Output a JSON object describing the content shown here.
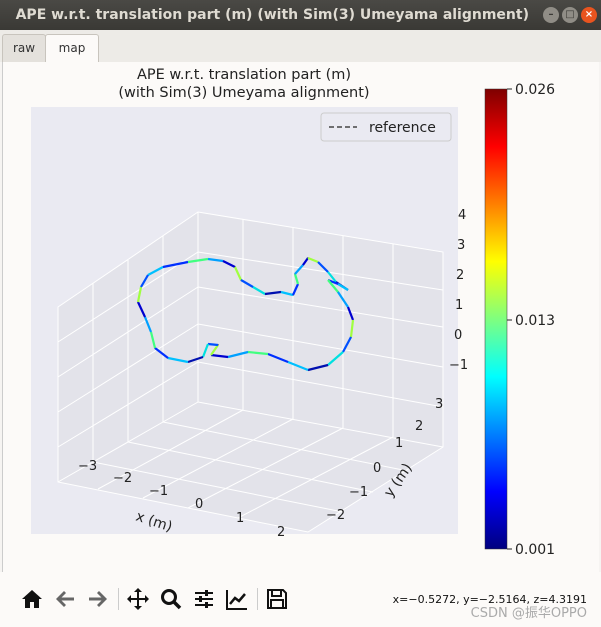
{
  "window": {
    "title": "APE w.r.t. translation part (m) (with Sim(3) Umeyama alignment)"
  },
  "tabs": [
    {
      "label": "raw",
      "active": false
    },
    {
      "label": "map",
      "active": true
    }
  ],
  "plot": {
    "title_line1": "APE w.r.t. translation part (m)",
    "title_line2": "(with Sim(3) Umeyama alignment)",
    "legend": "reference",
    "xlabel": "x (m)",
    "ylabel": "y (m)",
    "xticks": [
      "−3",
      "−2",
      "−1",
      "0",
      "1",
      "2"
    ],
    "yticks": [
      "−2",
      "−1",
      "0",
      "1",
      "2",
      "3"
    ],
    "zticks": [
      "−1",
      "0",
      "1",
      "2",
      "3",
      "4"
    ],
    "colorbar": {
      "colormap": "jet",
      "min": "0.001",
      "mid": "0.013",
      "max": "0.026"
    }
  },
  "toolbar": {
    "icons": [
      "home-icon",
      "back-icon",
      "forward-icon",
      "pan-icon",
      "zoom-icon",
      "configure-subplots-icon",
      "edit-axes-icon",
      "save-icon"
    ],
    "coords": "x=−0.5272, y=−2.5164, z=4.3191"
  },
  "watermark": "CSDN @振华OPPO"
}
